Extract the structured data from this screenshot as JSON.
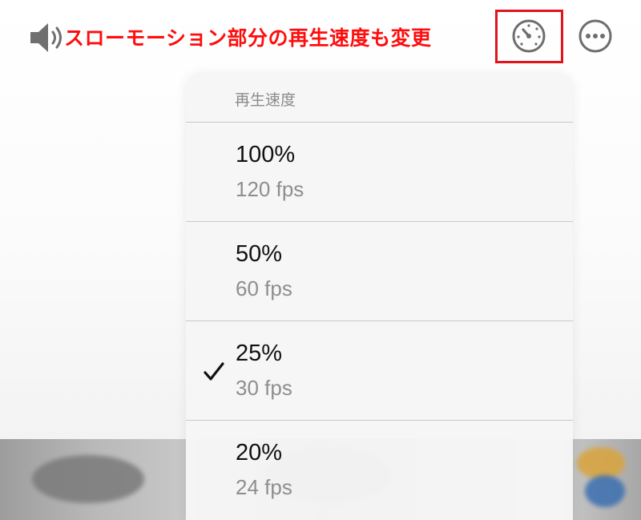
{
  "annotation": {
    "text": "スローモーション部分の再生速度も変更",
    "color": "#ff0d0d"
  },
  "toolbar": {
    "volume_icon": "speaker-wave-icon",
    "speed_icon": "speedometer-icon",
    "more_icon": "ellipsis-circle-icon",
    "highlight_color": "#e0161c"
  },
  "menu": {
    "title": "再生速度",
    "items": [
      {
        "label": "100%",
        "sub": "120 fps",
        "selected": false
      },
      {
        "label": "50%",
        "sub": "60 fps",
        "selected": false
      },
      {
        "label": "25%",
        "sub": "30 fps",
        "selected": true
      },
      {
        "label": "20%",
        "sub": "24 fps",
        "selected": false
      }
    ]
  }
}
